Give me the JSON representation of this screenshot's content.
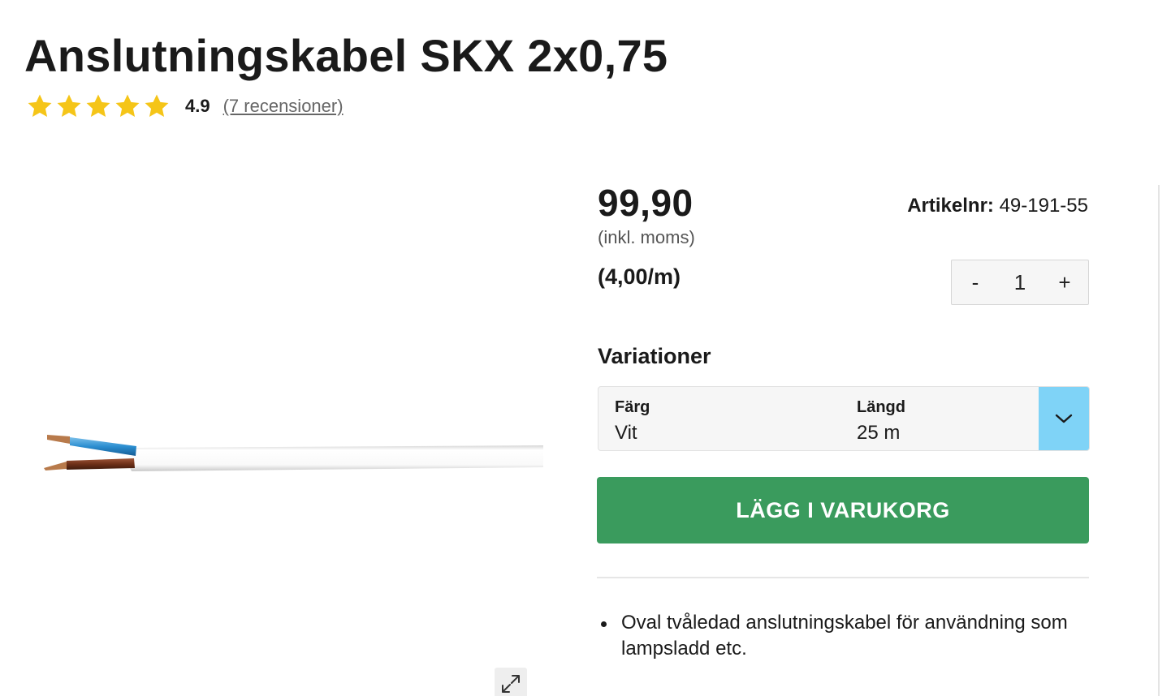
{
  "product": {
    "title": "Anslutningskabel SKX 2x0,75",
    "rating": {
      "stars": 5,
      "value": "4.9",
      "reviews_link": "(7 recensioner)",
      "star_color": "#f5c518"
    },
    "price": "99,90",
    "vat_note": "(inkl. moms)",
    "unit_price": "(4,00/m)",
    "article": {
      "label": "Artikelnr:",
      "number": "49-191-55"
    }
  },
  "quantity": {
    "decrement_label": "-",
    "value": "1",
    "increment_label": "+"
  },
  "variations": {
    "heading": "Variationer",
    "color_label": "Färg",
    "color_value": "Vit",
    "length_label": "Längd",
    "length_value": "25 m",
    "arrow_icon": "chevron-down-icon",
    "arrow_bg": "#7fd3f7"
  },
  "cart": {
    "button_label": "LÄGG I VARUKORG",
    "button_color": "#3a9b5d"
  },
  "features": [
    "Oval tvåledad anslutningskabel för användning som lampsladd etc."
  ],
  "image": {
    "expand_icon": "expand-icon"
  }
}
